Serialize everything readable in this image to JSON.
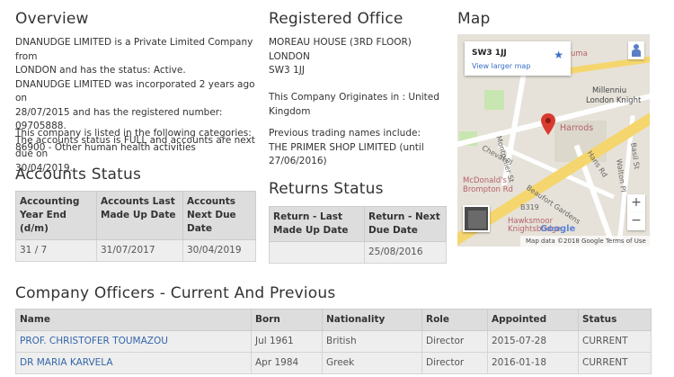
{
  "overview": {
    "heading": "Overview",
    "lines": [
      "DNANUDGE LIMITED is a Private Limited Company from",
      "LONDON and has the status: Active.",
      "DNANUDGE LIMITED was incorporated 2 years ago on",
      "28/07/2015 and has the registered number: 09705888.",
      "The accounts status is FULL and accounts are next due on",
      "30/04/2019."
    ],
    "category_lines": [
      "This company is listed in the following categories:",
      "86900 - Other human health activities"
    ]
  },
  "registered_office": {
    "heading": "Registered Office",
    "address_lines": [
      "MOREAU HOUSE (3RD FLOOR)",
      "LONDON",
      "SW3 1JJ"
    ],
    "origin_lines": [
      "This Company Originates in : United",
      "Kingdom"
    ],
    "trading_lines": [
      "Previous trading names include:",
      "THE PRIMER SHOP LIMITED (until",
      "27/06/2016)"
    ]
  },
  "map": {
    "heading": "Map",
    "postcode": "SW3 1JJ",
    "view_larger": "View larger map",
    "labels": {
      "harrods": "Harrods",
      "millennium": "Millenniu",
      "knights": "London Knight",
      "mcdonalds": "McDonald's -",
      "brompton": "Brompton Rd",
      "hawksmoor": "Hawksmoor",
      "knightsbridge": "Knightsbridge",
      "uma": "uma",
      "b319": "B319",
      "montpelier": "Montpelier St",
      "cheval": "Cheval Pl",
      "hans": "Hans Rd",
      "beaufort": "Beaufort Gardens",
      "walton": "Walton Pl",
      "basil": "Basil St",
      "google": "Google"
    },
    "zoom_in": "+",
    "zoom_out": "−",
    "footer": "Map data ©2018 Google   Terms of Use"
  },
  "accounts_status": {
    "heading": "Accounts Status",
    "columns": [
      "Accounting Year End (d/m)",
      "Accounts Last Made Up Date",
      "Accounts Next Due Date"
    ],
    "rows": [
      [
        "31 / 7",
        "31/07/2017",
        "30/04/2019"
      ]
    ]
  },
  "returns_status": {
    "heading": "Returns Status",
    "columns": [
      "Return - Last Made Up Date",
      "Return - Next Due Date"
    ],
    "rows": [
      [
        "",
        "25/08/2016"
      ]
    ]
  },
  "officers": {
    "heading": "Company Officers - Current And Previous",
    "columns": [
      "Name",
      "Born",
      "Nationality",
      "Role",
      "Appointed",
      "Status"
    ],
    "rows": [
      [
        "PROF. CHRISTOFER TOUMAZOU",
        "Jul 1961",
        "British",
        "Director",
        "2015-07-28",
        "CURRENT"
      ],
      [
        "DR MARIA KARVELA",
        "Apr 1984",
        "Greek",
        "Director",
        "2016-01-18",
        "CURRENT"
      ]
    ]
  },
  "colors": {
    "link": "#3366aa",
    "header_bg": "#dddddd",
    "cell_bg": "#eeeeee",
    "map_pin": "#d93a2f"
  }
}
